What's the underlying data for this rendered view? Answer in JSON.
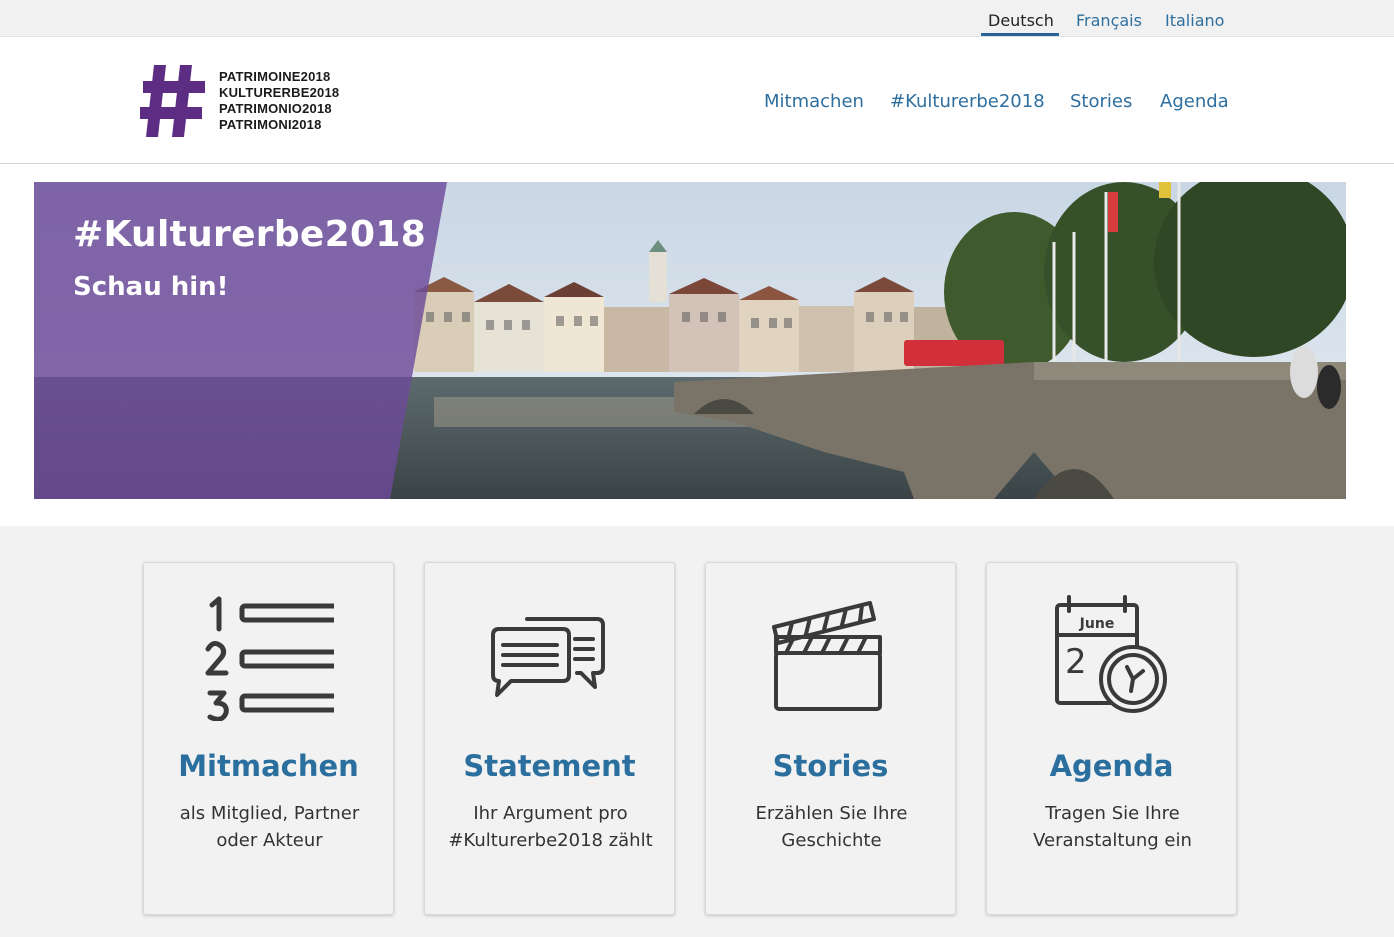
{
  "languages": [
    {
      "label": "Deutsch",
      "active": true
    },
    {
      "label": "Français",
      "active": false
    },
    {
      "label": "Italiano",
      "active": false
    }
  ],
  "logo": {
    "lines": [
      "PATRIMOINE2018",
      "KULTURERBE2018",
      "PATRIMONIO2018",
      "PATRIMONI2018"
    ],
    "mark_color": "#5c2d83"
  },
  "nav": [
    "Mitmachen",
    "#Kulturerbe2018",
    "Stories",
    "Agenda"
  ],
  "hero": {
    "title": "#Kulturerbe2018",
    "subtitle": "Schau hin!",
    "overlay_color": "#6c4a98"
  },
  "cards": [
    {
      "icon": "numbered-list-icon",
      "title": "Mitmachen",
      "desc": "als Mitglied, Partner oder Akteur"
    },
    {
      "icon": "speech-bubbles-icon",
      "title": "Statement",
      "desc": "Ihr Argument pro #Kulturerbe2018 zählt"
    },
    {
      "icon": "clapperboard-icon",
      "title": "Stories",
      "desc": "Erzählen Sie Ihre Geschichte"
    },
    {
      "icon": "calendar-clock-icon",
      "title": "Agenda",
      "desc": "Tragen Sie Ihre Veranstaltung ein",
      "calendar_month": "June",
      "calendar_day": "2"
    }
  ],
  "colors": {
    "link": "#2f6f9f",
    "card_title": "#2a6f9e",
    "accent_underline": "#2a6496"
  }
}
